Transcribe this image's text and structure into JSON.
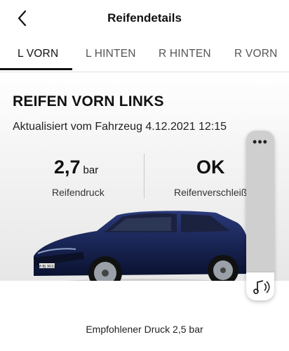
{
  "header": {
    "title": "Reifendetails",
    "back_icon": "chevron-left-icon"
  },
  "tabs": [
    {
      "label": "L VORN",
      "active": true
    },
    {
      "label": "L HINTEN",
      "active": false
    },
    {
      "label": "R HINTEN",
      "active": false
    },
    {
      "label": "R VORN",
      "active": false
    }
  ],
  "card": {
    "heading": "REIFEN VORN LINKS",
    "updated": "Aktualisiert vom Fahrzeug 4.12.2021 12:15",
    "pressure": {
      "value": "2,7",
      "unit": "bar",
      "label": "Reifendruck"
    },
    "wear": {
      "value": "OK",
      "label": "Reifenverschleiß"
    },
    "car_plate": "M-BJ 9022"
  },
  "recommendation": "Empfohlener Druck 2,5 bar",
  "side_panel": {
    "menu_icon": "more-dots-icon",
    "action_icon": "music-note-icon"
  }
}
